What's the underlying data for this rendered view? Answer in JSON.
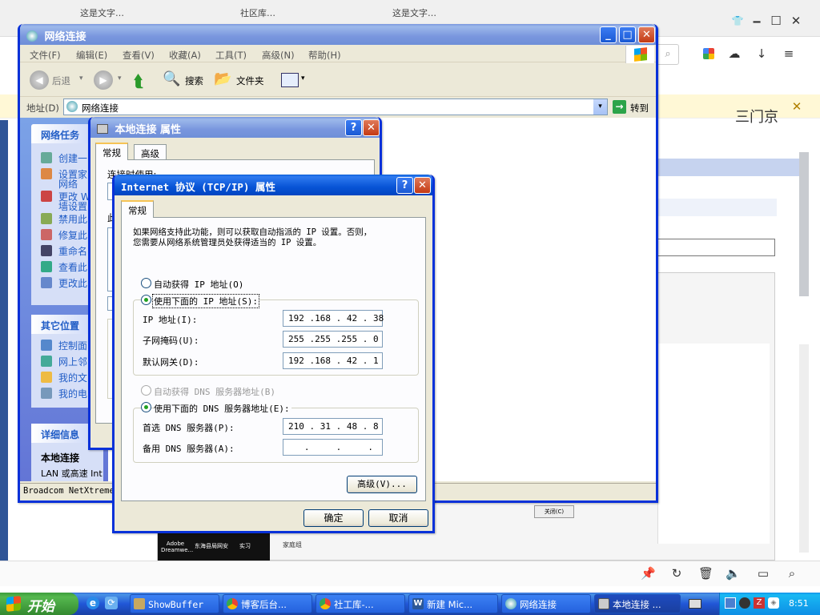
{
  "browser": {
    "tabs": [
      "这是文字…",
      "社区库…",
      "这是文字…"
    ],
    "infobar_close": "✕",
    "window_controls": [
      "🗕",
      "☐",
      "✕"
    ],
    "bottom_icons": [
      "pin-icon",
      "refresh-icon",
      "trash-icon",
      "volume-icon",
      "window-icon",
      "search-icon"
    ],
    "page_snippets": {
      "partial_heading": "三门京",
      "close_label": "关闭(C)",
      "family_link": "家庭组"
    },
    "dock_icons": [
      "Adobe Dreamwe...",
      "东海县局网安",
      "实习"
    ]
  },
  "netconn": {
    "title": "网络连接",
    "menu": [
      "文件(F)",
      "编辑(E)",
      "查看(V)",
      "收藏(A)",
      "工具(T)",
      "高级(N)",
      "帮助(H)"
    ],
    "toolbar": {
      "back": "后退",
      "search": "搜索",
      "folders": "文件夹"
    },
    "address_label": "地址(D)",
    "address_value": "网络连接",
    "go_label": "转到",
    "tasks_header": "网络任务",
    "tasks": [
      "创建一",
      "设置家",
      "网络",
      "更改 W",
      "墙设置",
      "禁用此",
      "修复此",
      "重命名",
      "查看此",
      "更改此"
    ],
    "other_header": "其它位置",
    "other": [
      "控制面",
      "网上邻",
      "我的文",
      "我的电"
    ],
    "details_header": "详细信息",
    "details_title": "本地连接",
    "details_text": "LAN 或高速 Int",
    "status_text": "Broadcom NetXtreme"
  },
  "localconn": {
    "title": "本地连接 属性",
    "tabs": [
      "常规",
      "高级"
    ],
    "connect_using": "连接时使用:",
    "items_label": "此"
  },
  "tcpip": {
    "title": "Internet 协议 (TCP/IP) 属性",
    "tab": "常规",
    "desc_line1": "如果网络支持此功能，则可以获取自动指派的 IP 设置。否则，",
    "desc_line2": "您需要从网络系统管理员处获得适当的 IP 设置。",
    "auto_ip": "自动获得 IP 地址(O)",
    "manual_ip": "使用下面的 IP 地址(S):",
    "ip_label": "IP 地址(I):",
    "ip_value": "192 .168 . 42 . 38",
    "mask_label": "子网掩码(U):",
    "mask_value": "255 .255 .255 . 0",
    "gateway_label": "默认网关(D):",
    "gateway_value": "192 .168 . 42 . 1",
    "auto_dns": "自动获得 DNS 服务器地址(B)",
    "manual_dns": "使用下面的 DNS 服务器地址(E):",
    "dns1_label": "首选 DNS 服务器(P):",
    "dns1_value": "210 . 31 . 48 . 8",
    "dns2_label": "备用 DNS 服务器(A):",
    "dns2_value": "   .     .     .  ",
    "advanced": "高级(V)...",
    "ok": "确定",
    "cancel": "取消"
  },
  "taskbar": {
    "start": "开始",
    "items": [
      "ShowBuffer",
      "博客后台...",
      "社工库-...",
      "新建 Mic...",
      "网络连接",
      "本地连接 ..."
    ],
    "clock": "8:51"
  }
}
